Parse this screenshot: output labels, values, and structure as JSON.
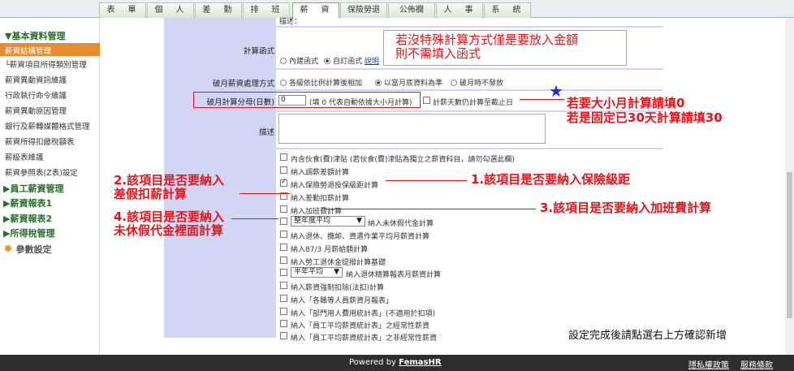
{
  "tabs": [
    "表　單",
    "個　人",
    "差　勤",
    "排　班",
    "薪　資",
    "保險勞退",
    "公佈欄",
    "人　事",
    "系　統"
  ],
  "sidebar": {
    "group1": "▼基本資料管理",
    "items": [
      "薪資結構管理",
      "└薪資項目所得類別管理",
      "薪資異動資訊維護",
      "行政執行命令維護",
      "薪資異動原因管理",
      "銀行及薪轉媒體格式管理",
      "薪資所得扣繳稅額表",
      "薪級表維護",
      "薪資參照表(Z表)設定"
    ],
    "groups": [
      "▶員工薪資管理",
      "▶薪資報表1",
      "▶薪資報表2",
      "▶所得稅管理"
    ],
    "settings": "參數設定"
  },
  "form": {
    "desc_top": "描述：",
    "calc_label": "計算函式",
    "calc_opt1": "內建函式",
    "calc_opt2": "自訂函式",
    "calc_link": "說明",
    "calc_note": "若沒特殊計算方式僅是要放入金額\n則不需填入函式",
    "broken_label": "破月薪資處理方式",
    "broken_opt1": "各級依比例計算後相加",
    "broken_opt2": "以當月底資料為準",
    "broken_opt3": "破月時不發放",
    "denom_label": "破月計算分母(日數)",
    "denom_value": "0",
    "denom_hint": "(填 0 代表自動依據大小月計算)",
    "denom_cb": "計薪天數仍計算至截止日",
    "desc_label": "描述",
    "checks": [
      "內含伙食(費)津貼 (若伙食(費)津貼為獨立之薪資科目，請勿勾選此欄)",
      "納入調薪差額計算",
      "納入保險勞退投保級距計算",
      "納入差勤扣薪計算",
      "納入加班費計算",
      "納入未休假代金計算",
      "納入退休、撫卹、資遣作業平均月薪資計算",
      "納入87/3 月薪給額計算",
      "納入勞工退休金提撥計算基礎",
      "納入退休精算報表月薪資計算",
      "納入薪資強制扣除(法扣)計算",
      "納入「各職等人員薪資月報表」",
      "納入「部門用人費用統計表」(不適用於扣項)",
      "納入「員工平均薪資統計表」之經常性薪資",
      "納入「員工平均薪資統計表」之非經常性薪資"
    ],
    "select1": "整年度平均",
    "select2": "半年平均"
  },
  "annotations": {
    "n1": "1.該項目是否要納入保險級距",
    "n2": "2.該項目是否要納入\n差假扣薪計算",
    "n3": "3.該項目是否要納入加班費計算",
    "n4": "4.該項目是否要納入\n未休假代金裡面計算",
    "big": "若要大小月計算請填0\n若是固定已30天計算請填30",
    "confirm": "設定完成後請點選右上方確認新增"
  },
  "footer": {
    "powered": "Powered by",
    "brand": "FemasHR",
    "privacy": "隱私權政策",
    "terms": "服務條款"
  }
}
